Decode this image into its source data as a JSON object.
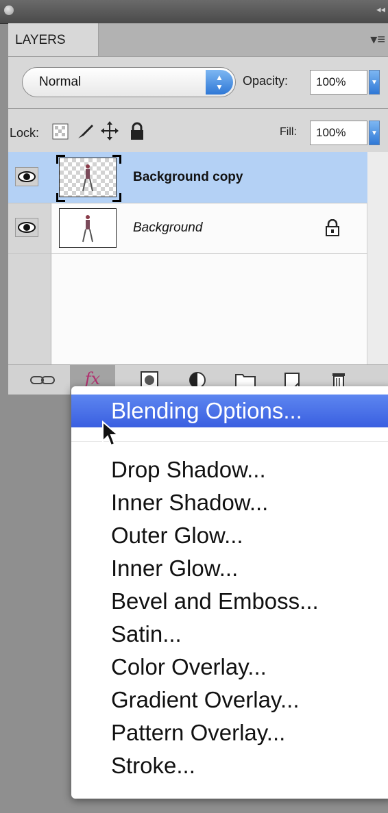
{
  "panel": {
    "tab_label": "LAYERS",
    "blend_mode": "Normal",
    "opacity_label": "Opacity:",
    "opacity_value": "100%",
    "lock_label": "Lock:",
    "fill_label": "Fill:",
    "fill_value": "100%"
  },
  "layers": [
    {
      "name": "Background copy",
      "selected": true,
      "style": "bold"
    },
    {
      "name": "Background",
      "selected": false,
      "style": "italic",
      "locked": true
    }
  ],
  "bottom_bar": {
    "fx_label": "fx"
  },
  "fx_menu": {
    "highlighted": "Blending Options...",
    "items": [
      "Drop Shadow...",
      "Inner Shadow...",
      "Outer Glow...",
      "Inner Glow...",
      "Bevel and Emboss...",
      "Satin...",
      "Color Overlay...",
      "Gradient Overlay...",
      "Pattern Overlay...",
      "Stroke..."
    ]
  },
  "colors": {
    "selection": "#b4d1f5",
    "menu_highlight": "#3a5fe0",
    "fx_magenta": "#b0306f"
  }
}
